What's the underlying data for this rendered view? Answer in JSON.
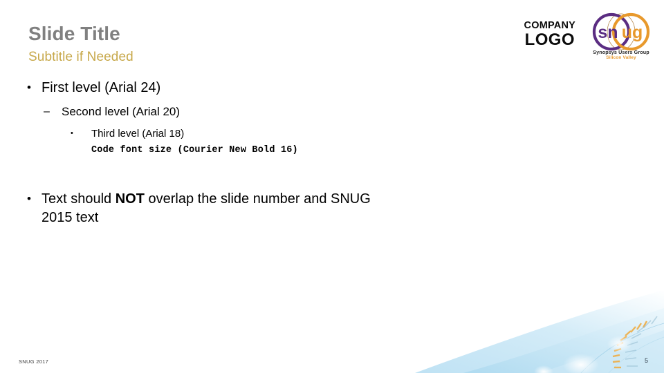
{
  "slide": {
    "title": "Slide Title",
    "subtitle": "Subtitle if Needed",
    "background_color": "#ffffff",
    "title_color": "#808080",
    "subtitle_color": "#c7a84a"
  },
  "logos": {
    "company": {
      "line1": "COMPANY",
      "line2": "LOGO"
    },
    "snug": {
      "wordmark_part1": "sn",
      "wordmark_part2": "ug",
      "tagline1": "Synopsys Users Group",
      "tagline2": "Silicon Valley",
      "purple": "#5b2d82",
      "orange": "#e8992c"
    }
  },
  "body": {
    "level1_a": "First level (Arial 24)",
    "level2": "Second level (Arial 20)",
    "level3": "Third level (Arial 18)",
    "code": "Code font size (Courier New Bold 16)",
    "level1_b_pre": "Text should ",
    "level1_b_strong": "NOT",
    "level1_b_post": " overlap the slide number and SNUG 2015 text",
    "bullet_glyph_level1": "•",
    "bullet_glyph_level2": "–",
    "bullet_glyph_level3": "•"
  },
  "footer": {
    "copyright": "SNUG 2017",
    "page_number": "5"
  }
}
